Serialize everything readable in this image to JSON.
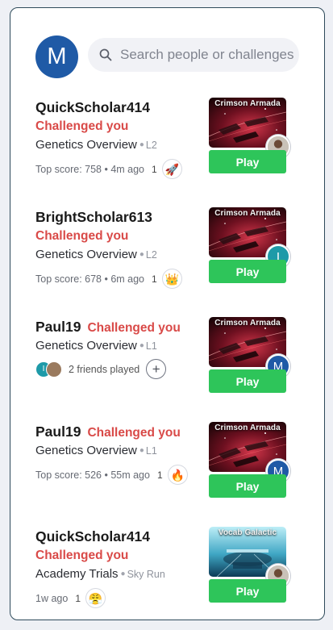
{
  "me": {
    "initial": "M"
  },
  "search": {
    "placeholder": "Search people or challenges"
  },
  "challenges": [
    {
      "name": "QuickScholar414",
      "status": "Challenged you",
      "topic": "Genetics Overview",
      "level": "L2",
      "meta": "Top score: 758 • 4m ago",
      "count": "1",
      "reaction": "🚀",
      "game": "Crimson Armada",
      "opponent_avatar": "photo",
      "play": "Play"
    },
    {
      "name": "BrightScholar613",
      "status": "Challenged you",
      "topic": "Genetics Overview",
      "level": "L2",
      "meta": "Top score: 678 • 6m ago",
      "count": "1",
      "reaction": "👑",
      "game": "Crimson Armada",
      "opponent_avatar": "I",
      "play": "Play"
    },
    {
      "name": "Paul19",
      "status": "Challenged you",
      "topic": "Genetics Overview",
      "level": "L1",
      "friends_played": "2 friends played",
      "friend_initial": "I",
      "plus": "+",
      "game": "Crimson Armada",
      "opponent_avatar": "M",
      "play": "Play"
    },
    {
      "name": "Paul19",
      "status": "Challenged you",
      "topic": "Genetics Overview",
      "level": "L1",
      "meta": "Top score: 526 • 55m ago",
      "count": "1",
      "reaction": "🔥",
      "game": "Crimson Armada",
      "opponent_avatar": "M",
      "play": "Play"
    },
    {
      "name": "QuickScholar414",
      "status": "Challenged you",
      "topic": "Academy Trials",
      "level": "Sky Run",
      "meta": "1w ago",
      "count": "1",
      "reaction": "😤",
      "game": "Vocab Galactic",
      "opponent_avatar": "photo",
      "play": "Play"
    }
  ],
  "colors": {
    "accent_red": "#d94a48",
    "play_green": "#2ec55a",
    "avatar_blue": "#1f5aa6",
    "avatar_teal": "#1e9aa8"
  }
}
